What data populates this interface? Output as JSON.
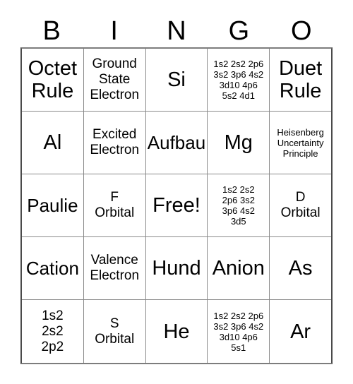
{
  "card": {
    "title_letters": [
      "B",
      "I",
      "N",
      "G",
      "O"
    ],
    "rows": [
      [
        {
          "text": "Octet\nRule",
          "size": "xl"
        },
        {
          "text": "Ground\nState\nElectron",
          "size": "md"
        },
        {
          "text": "Si",
          "size": "xl"
        },
        {
          "text": "1s2 2s2 2p6\n3s2 3p6 4s2\n3d10 4p6\n5s2 4d1",
          "size": "xs"
        },
        {
          "text": "Duet\nRule",
          "size": "xl"
        }
      ],
      [
        {
          "text": "Al",
          "size": "xl"
        },
        {
          "text": "Excited\nElectron",
          "size": "md"
        },
        {
          "text": "Aufbau",
          "size": "lg"
        },
        {
          "text": "Mg",
          "size": "xl"
        },
        {
          "text": "Heisenberg\nUncertainty\nPrinciple",
          "size": "xs"
        }
      ],
      [
        {
          "text": "Paulie",
          "size": "lg"
        },
        {
          "text": "F\nOrbital",
          "size": "md"
        },
        {
          "text": "Free!",
          "size": "xl"
        },
        {
          "text": "1s2 2s2\n2p6 3s2\n3p6 4s2\n3d5",
          "size": "xs"
        },
        {
          "text": "D\nOrbital",
          "size": "md"
        }
      ],
      [
        {
          "text": "Cation",
          "size": "lg"
        },
        {
          "text": "Valence\nElectron",
          "size": "md"
        },
        {
          "text": "Hund",
          "size": "xl"
        },
        {
          "text": "Anion",
          "size": "xl"
        },
        {
          "text": "As",
          "size": "xl"
        }
      ],
      [
        {
          "text": "1s2\n2s2\n2p2",
          "size": "md"
        },
        {
          "text": "S\nOrbital",
          "size": "md"
        },
        {
          "text": "He",
          "size": "xl"
        },
        {
          "text": "1s2 2s2 2p6\n3s2 3p6 4s2\n3d10 4p6\n5s1",
          "size": "xs"
        },
        {
          "text": "Ar",
          "size": "xl"
        }
      ]
    ]
  }
}
